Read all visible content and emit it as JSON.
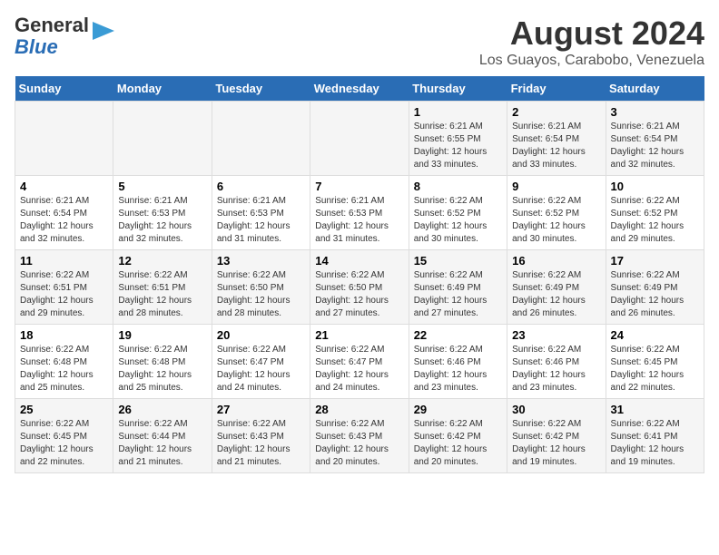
{
  "logo": {
    "line1": "General",
    "line2": "Blue"
  },
  "title": "August 2024",
  "subtitle": "Los Guayos, Carabobo, Venezuela",
  "days_of_week": [
    "Sunday",
    "Monday",
    "Tuesday",
    "Wednesday",
    "Thursday",
    "Friday",
    "Saturday"
  ],
  "weeks": [
    [
      {
        "day": "",
        "info": ""
      },
      {
        "day": "",
        "info": ""
      },
      {
        "day": "",
        "info": ""
      },
      {
        "day": "",
        "info": ""
      },
      {
        "day": "1",
        "info": "Sunrise: 6:21 AM\nSunset: 6:55 PM\nDaylight: 12 hours\nand 33 minutes."
      },
      {
        "day": "2",
        "info": "Sunrise: 6:21 AM\nSunset: 6:54 PM\nDaylight: 12 hours\nand 33 minutes."
      },
      {
        "day": "3",
        "info": "Sunrise: 6:21 AM\nSunset: 6:54 PM\nDaylight: 12 hours\nand 32 minutes."
      }
    ],
    [
      {
        "day": "4",
        "info": "Sunrise: 6:21 AM\nSunset: 6:54 PM\nDaylight: 12 hours\nand 32 minutes."
      },
      {
        "day": "5",
        "info": "Sunrise: 6:21 AM\nSunset: 6:53 PM\nDaylight: 12 hours\nand 32 minutes."
      },
      {
        "day": "6",
        "info": "Sunrise: 6:21 AM\nSunset: 6:53 PM\nDaylight: 12 hours\nand 31 minutes."
      },
      {
        "day": "7",
        "info": "Sunrise: 6:21 AM\nSunset: 6:53 PM\nDaylight: 12 hours\nand 31 minutes."
      },
      {
        "day": "8",
        "info": "Sunrise: 6:22 AM\nSunset: 6:52 PM\nDaylight: 12 hours\nand 30 minutes."
      },
      {
        "day": "9",
        "info": "Sunrise: 6:22 AM\nSunset: 6:52 PM\nDaylight: 12 hours\nand 30 minutes."
      },
      {
        "day": "10",
        "info": "Sunrise: 6:22 AM\nSunset: 6:52 PM\nDaylight: 12 hours\nand 29 minutes."
      }
    ],
    [
      {
        "day": "11",
        "info": "Sunrise: 6:22 AM\nSunset: 6:51 PM\nDaylight: 12 hours\nand 29 minutes."
      },
      {
        "day": "12",
        "info": "Sunrise: 6:22 AM\nSunset: 6:51 PM\nDaylight: 12 hours\nand 28 minutes."
      },
      {
        "day": "13",
        "info": "Sunrise: 6:22 AM\nSunset: 6:50 PM\nDaylight: 12 hours\nand 28 minutes."
      },
      {
        "day": "14",
        "info": "Sunrise: 6:22 AM\nSunset: 6:50 PM\nDaylight: 12 hours\nand 27 minutes."
      },
      {
        "day": "15",
        "info": "Sunrise: 6:22 AM\nSunset: 6:49 PM\nDaylight: 12 hours\nand 27 minutes."
      },
      {
        "day": "16",
        "info": "Sunrise: 6:22 AM\nSunset: 6:49 PM\nDaylight: 12 hours\nand 26 minutes."
      },
      {
        "day": "17",
        "info": "Sunrise: 6:22 AM\nSunset: 6:49 PM\nDaylight: 12 hours\nand 26 minutes."
      }
    ],
    [
      {
        "day": "18",
        "info": "Sunrise: 6:22 AM\nSunset: 6:48 PM\nDaylight: 12 hours\nand 25 minutes."
      },
      {
        "day": "19",
        "info": "Sunrise: 6:22 AM\nSunset: 6:48 PM\nDaylight: 12 hours\nand 25 minutes."
      },
      {
        "day": "20",
        "info": "Sunrise: 6:22 AM\nSunset: 6:47 PM\nDaylight: 12 hours\nand 24 minutes."
      },
      {
        "day": "21",
        "info": "Sunrise: 6:22 AM\nSunset: 6:47 PM\nDaylight: 12 hours\nand 24 minutes."
      },
      {
        "day": "22",
        "info": "Sunrise: 6:22 AM\nSunset: 6:46 PM\nDaylight: 12 hours\nand 23 minutes."
      },
      {
        "day": "23",
        "info": "Sunrise: 6:22 AM\nSunset: 6:46 PM\nDaylight: 12 hours\nand 23 minutes."
      },
      {
        "day": "24",
        "info": "Sunrise: 6:22 AM\nSunset: 6:45 PM\nDaylight: 12 hours\nand 22 minutes."
      }
    ],
    [
      {
        "day": "25",
        "info": "Sunrise: 6:22 AM\nSunset: 6:45 PM\nDaylight: 12 hours\nand 22 minutes."
      },
      {
        "day": "26",
        "info": "Sunrise: 6:22 AM\nSunset: 6:44 PM\nDaylight: 12 hours\nand 21 minutes."
      },
      {
        "day": "27",
        "info": "Sunrise: 6:22 AM\nSunset: 6:43 PM\nDaylight: 12 hours\nand 21 minutes."
      },
      {
        "day": "28",
        "info": "Sunrise: 6:22 AM\nSunset: 6:43 PM\nDaylight: 12 hours\nand 20 minutes."
      },
      {
        "day": "29",
        "info": "Sunrise: 6:22 AM\nSunset: 6:42 PM\nDaylight: 12 hours\nand 20 minutes."
      },
      {
        "day": "30",
        "info": "Sunrise: 6:22 AM\nSunset: 6:42 PM\nDaylight: 12 hours\nand 19 minutes."
      },
      {
        "day": "31",
        "info": "Sunrise: 6:22 AM\nSunset: 6:41 PM\nDaylight: 12 hours\nand 19 minutes."
      }
    ]
  ]
}
